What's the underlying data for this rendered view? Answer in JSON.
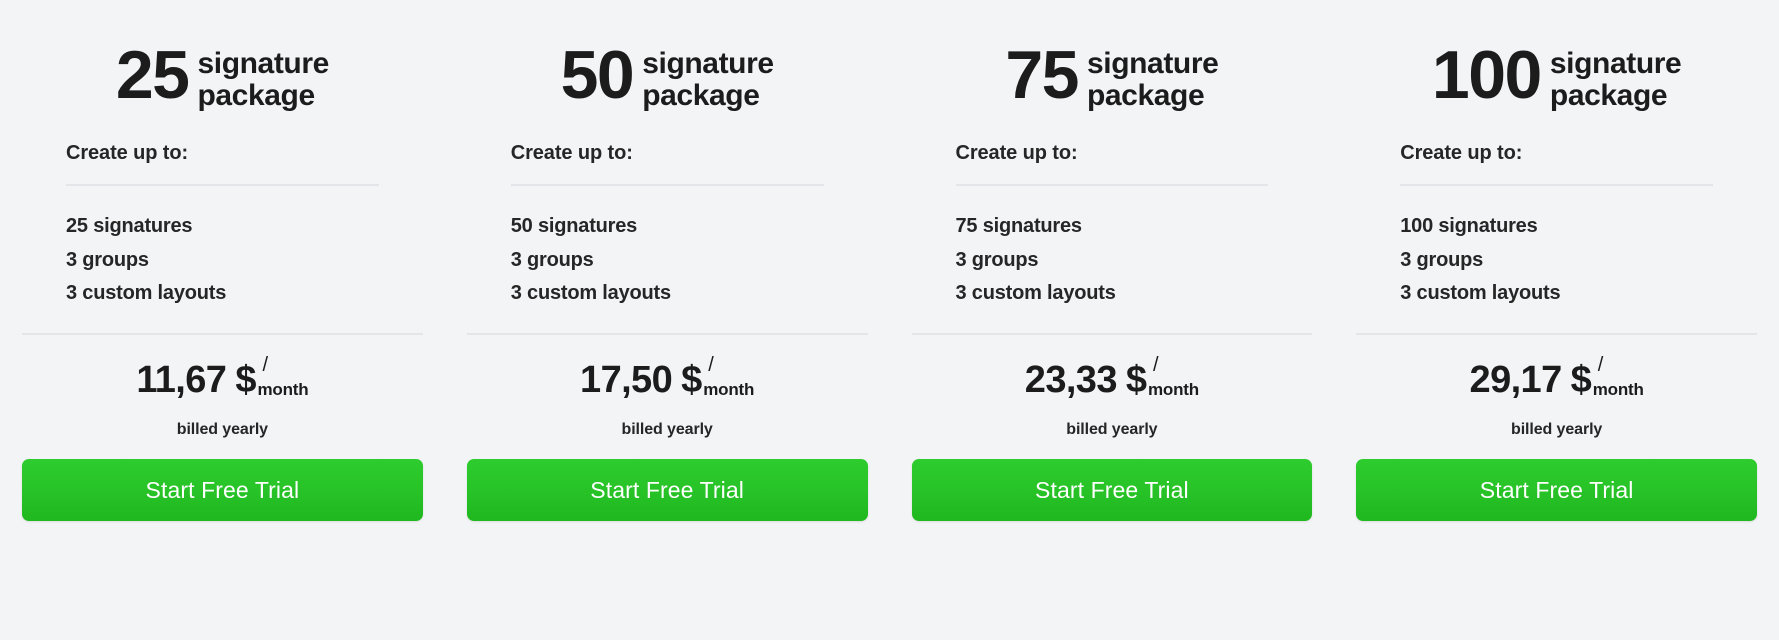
{
  "page": {
    "background_color": "#f3f4f6",
    "accent_color": "#2ecc2e",
    "text_color": "#1c1c1c",
    "divider_color": "#e3e5e8"
  },
  "common": {
    "title_suffix": "signature package",
    "create_label": "Create up to:",
    "currency": "$",
    "slash": "/",
    "period_unit": "month",
    "billing_note": "billed yearly",
    "cta_label": "Start Free Trial"
  },
  "plans": [
    {
      "count": "25",
      "title_line1": "signature",
      "title_line2": "package",
      "create_label": "Create up to:",
      "features": [
        "25 signatures",
        "3 groups",
        "3 custom layouts"
      ],
      "price": "11,67",
      "currency": "$",
      "slash": "/",
      "period_unit": "month",
      "billing_note": "billed yearly",
      "cta_label": "Start Free Trial"
    },
    {
      "count": "50",
      "title_line1": "signature",
      "title_line2": "package",
      "create_label": "Create up to:",
      "features": [
        "50 signatures",
        "3 groups",
        "3 custom layouts"
      ],
      "price": "17,50",
      "currency": "$",
      "slash": "/",
      "period_unit": "month",
      "billing_note": "billed yearly",
      "cta_label": "Start Free Trial"
    },
    {
      "count": "75",
      "title_line1": "signature",
      "title_line2": "package",
      "create_label": "Create up to:",
      "features": [
        "75 signatures",
        "3 groups",
        "3 custom layouts"
      ],
      "price": "23,33",
      "currency": "$",
      "slash": "/",
      "period_unit": "month",
      "billing_note": "billed yearly",
      "cta_label": "Start Free Trial"
    },
    {
      "count": "100",
      "title_line1": "signature",
      "title_line2": "package",
      "create_label": "Create up to:",
      "features": [
        "100 signatures",
        "3 groups",
        "3 custom layouts"
      ],
      "price": "29,17",
      "currency": "$",
      "slash": "/",
      "period_unit": "month",
      "billing_note": "billed yearly",
      "cta_label": "Start Free Trial"
    }
  ]
}
